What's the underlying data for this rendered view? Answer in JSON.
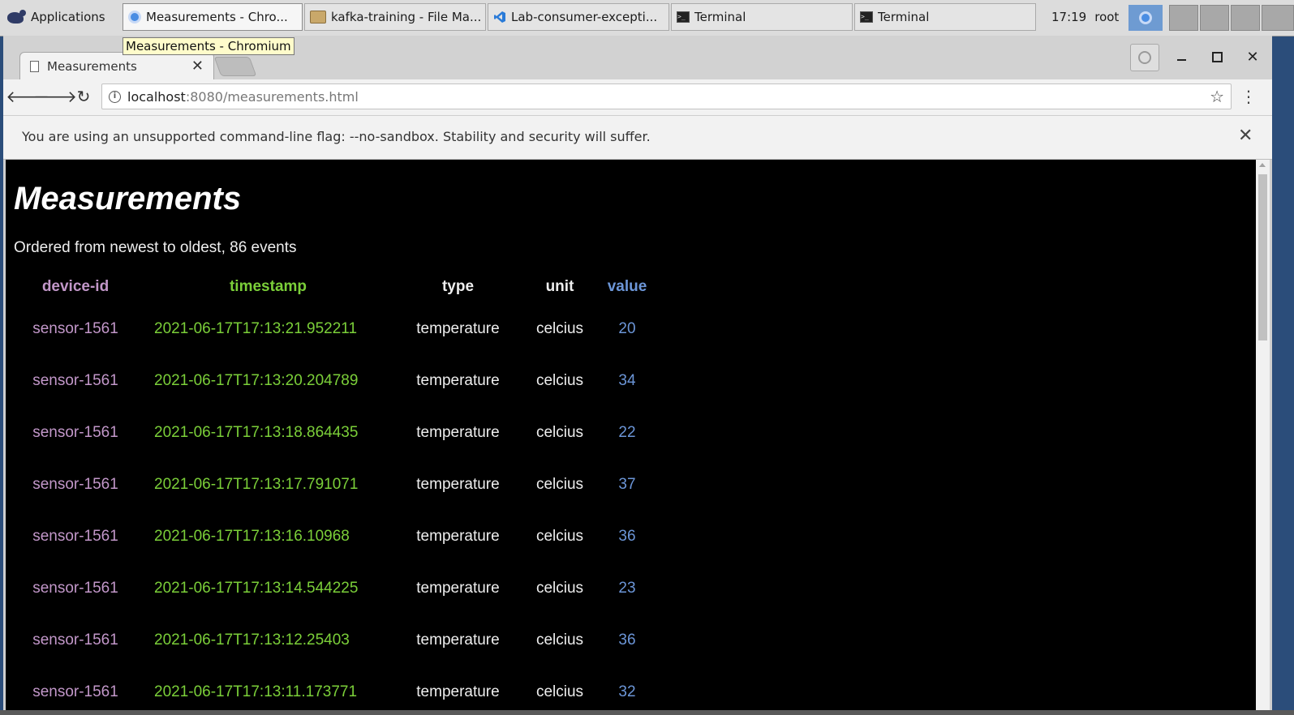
{
  "panel": {
    "applications_label": "Applications",
    "tasks": [
      {
        "label": "Measurements - Chro...",
        "icon": "chrome-icon",
        "active": true
      },
      {
        "label": "kafka-training - File Ma...",
        "icon": "folder-icon"
      },
      {
        "label": "Lab-consumer-excepti...",
        "icon": "vscode-icon"
      },
      {
        "label": "Terminal",
        "icon": "terminal-icon"
      },
      {
        "label": "Terminal",
        "icon": "terminal-icon"
      }
    ],
    "clock": "17:19",
    "user": "root"
  },
  "browser": {
    "tooltip": "Measurements - Chromium",
    "tab_title": "Measurements",
    "url_host": "localhost",
    "url_rest": ":8080/measurements.html",
    "infobar_message": "You are using an unsupported command-line flag: --no-sandbox. Stability and security will suffer."
  },
  "page": {
    "title": "Measurements",
    "subtitle": "Ordered from newest to oldest, 86 events",
    "columns": [
      "device-id",
      "timestamp",
      "type",
      "unit",
      "value"
    ],
    "rows": [
      [
        "sensor-1561",
        "2021-06-17T17:13:21.952211",
        "temperature",
        "celcius",
        "20"
      ],
      [
        "sensor-1561",
        "2021-06-17T17:13:20.204789",
        "temperature",
        "celcius",
        "34"
      ],
      [
        "sensor-1561",
        "2021-06-17T17:13:18.864435",
        "temperature",
        "celcius",
        "22"
      ],
      [
        "sensor-1561",
        "2021-06-17T17:13:17.791071",
        "temperature",
        "celcius",
        "37"
      ],
      [
        "sensor-1561",
        "2021-06-17T17:13:16.10968",
        "temperature",
        "celcius",
        "36"
      ],
      [
        "sensor-1561",
        "2021-06-17T17:13:14.544225",
        "temperature",
        "celcius",
        "23"
      ],
      [
        "sensor-1561",
        "2021-06-17T17:13:12.25403",
        "temperature",
        "celcius",
        "36"
      ],
      [
        "sensor-1561",
        "2021-06-17T17:13:11.173771",
        "temperature",
        "celcius",
        "32"
      ]
    ]
  },
  "colors": {
    "device_id": "#c297c9",
    "timestamp": "#7bcf39",
    "value": "#6c96d8",
    "page_background": "#000000"
  }
}
